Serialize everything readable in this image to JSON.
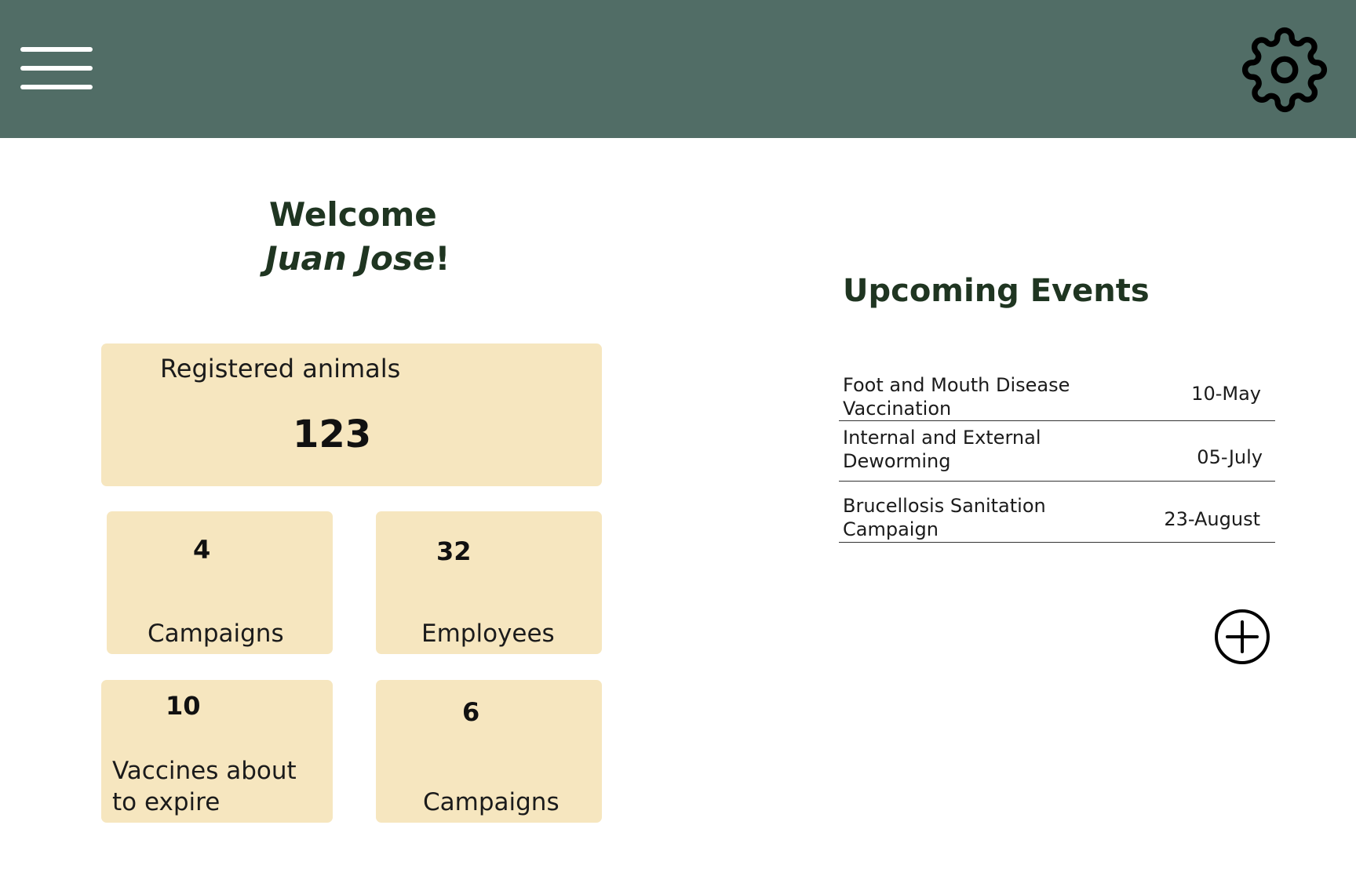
{
  "header": {
    "menu_icon": "hamburger-menu-icon",
    "settings_icon": "gear-icon",
    "background_color": "#516d66"
  },
  "welcome": {
    "greeting": "Welcome",
    "user_name": "Juan Jose",
    "exclamation": "!"
  },
  "stats": {
    "registered_animals": {
      "label": "Registered animals",
      "value": "123"
    },
    "campaigns": {
      "label": "Campaigns",
      "value": "4"
    },
    "employees": {
      "label": "Employees",
      "value": "32"
    },
    "vaccines_expiring": {
      "label": "Vaccines about to expire",
      "value": "10"
    },
    "campaigns_2": {
      "label": "Campaigns",
      "value": "6"
    },
    "card_color": "#f6e6bf"
  },
  "events": {
    "title": "Upcoming Events",
    "items": [
      {
        "name": "Foot and Mouth Disease Vaccination",
        "date": "10-May"
      },
      {
        "name": "Internal and External Deworming",
        "date": "05-July"
      },
      {
        "name": "Brucellosis Sanitation Campaign",
        "date": "23-August"
      }
    ],
    "add_icon": "plus-circle-icon"
  }
}
